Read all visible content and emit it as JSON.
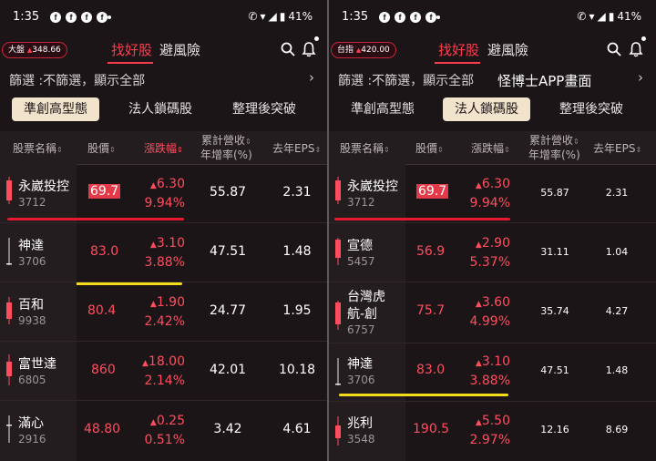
{
  "status": {
    "time": "1:35",
    "battery": "41%"
  },
  "colors": {
    "accent_red": "#ff3b4e",
    "active_subtab_bg": "#f2e3cc",
    "bg": "#1b1517",
    "marker_red": "#e8192c",
    "marker_yellow": "#f4dc1c"
  },
  "tabs": {
    "find_good": "找好股",
    "avoid_risk": "避風險"
  },
  "filter_text": "篩選 :不篩選，顯示全部",
  "watermark": "怪博士APP畫面",
  "subtabs": [
    "準創高型態",
    "法人鎖碼股",
    "整理後突破"
  ],
  "columns": {
    "name": "股票名稱",
    "price": "股價",
    "change": "漲跌幅",
    "rev_line1": "累計營收",
    "rev_line2": "年增率(%)",
    "eps": "去年EPS"
  },
  "left": {
    "index_label": "大盤",
    "index_value": "348.66",
    "active_subtab": 0,
    "rows": [
      {
        "name": "永崴投控",
        "code": "3712",
        "price": "69.7",
        "chg": "6.30",
        "pct": "9.94%",
        "rev": "55.87",
        "eps": "2.31"
      },
      {
        "name": "神達",
        "code": "3706",
        "price": "83.0",
        "chg": "3.10",
        "pct": "3.88%",
        "rev": "47.51",
        "eps": "1.48"
      },
      {
        "name": "百和",
        "code": "9938",
        "price": "80.4",
        "chg": "1.90",
        "pct": "2.42%",
        "rev": "24.77",
        "eps": "1.95"
      },
      {
        "name": "富世達",
        "code": "6805",
        "price": "860",
        "chg": "18.00",
        "pct": "2.14%",
        "rev": "42.01",
        "eps": "10.18"
      },
      {
        "name": "滿心",
        "code": "2916",
        "price": "48.80",
        "chg": "0.25",
        "pct": "0.51%",
        "rev": "3.42",
        "eps": "4.61"
      }
    ]
  },
  "right": {
    "index_label": "台指",
    "index_value": "420.00",
    "active_subtab": 1,
    "rows": [
      {
        "name": "永崴投控",
        "code": "3712",
        "price": "69.7",
        "chg": "6.30",
        "pct": "9.94%",
        "rev": "55.87",
        "eps": "2.31"
      },
      {
        "name": "宣德",
        "code": "5457",
        "price": "56.9",
        "chg": "2.90",
        "pct": "5.37%",
        "rev": "31.11",
        "eps": "1.04"
      },
      {
        "name_l1": "台灣虎",
        "name_l2": "航-創",
        "code": "6757",
        "price": "75.7",
        "chg": "3.60",
        "pct": "4.99%",
        "rev": "35.74",
        "eps": "4.27"
      },
      {
        "name": "神達",
        "code": "3706",
        "price": "83.0",
        "chg": "3.10",
        "pct": "3.88%",
        "rev": "47.51",
        "eps": "1.48"
      },
      {
        "name": "兆利",
        "code": "3548",
        "price": "190.5",
        "chg": "5.50",
        "pct": "2.97%",
        "rev": "12.16",
        "eps": "8.69"
      }
    ]
  }
}
